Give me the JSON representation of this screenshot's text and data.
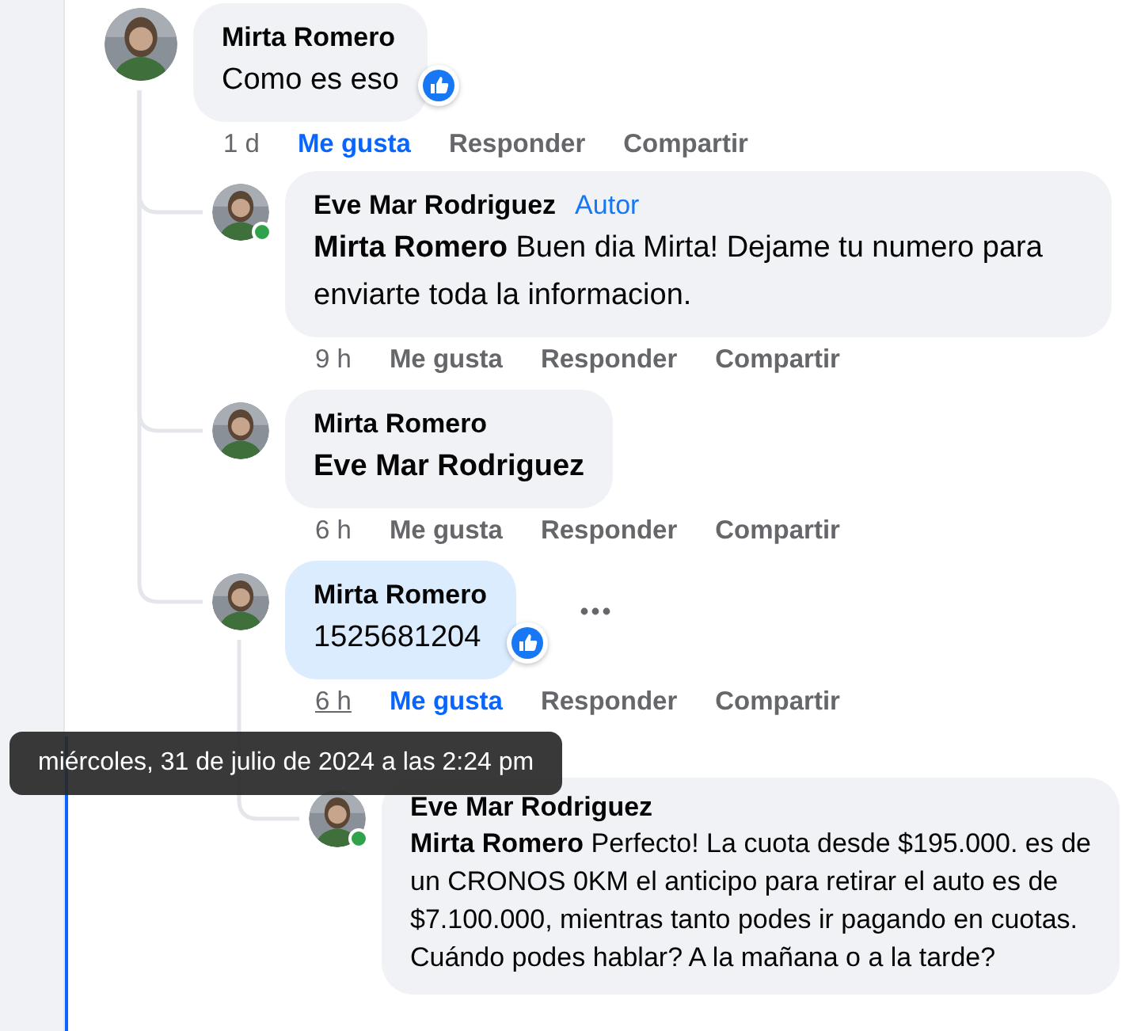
{
  "comments": [
    {
      "author": "Mirta Romero",
      "text": "Como es eso",
      "time": "1 d",
      "actions": [
        "Me gusta",
        "Responder",
        "Compartir"
      ],
      "liked": true,
      "like_badge": true,
      "online": false,
      "highlighted": false,
      "time_hovered": false,
      "more_button": false,
      "children": [
        {
          "author": "Eve Mar Rodriguez",
          "badge": "Autor",
          "mention": "Mirta Romero",
          "text": "Buen dia Mirta! Dejame tu numero para enviarte toda la informacion.",
          "time": "9 h",
          "actions": [
            "Me gusta",
            "Responder",
            "Compartir"
          ],
          "liked": false,
          "like_badge": false,
          "online": true,
          "highlighted": false,
          "time_hovered": false,
          "more_button": false
        },
        {
          "author": "Mirta Romero",
          "mention": "Eve Mar Rodriguez",
          "time": "6 h",
          "actions": [
            "Me gusta",
            "Responder",
            "Compartir"
          ],
          "liked": false,
          "like_badge": false,
          "online": false,
          "highlighted": false,
          "time_hovered": false,
          "more_button": false
        },
        {
          "author": "Mirta Romero",
          "text": "1525681204",
          "time": "6 h",
          "actions": [
            "Me gusta",
            "Responder",
            "Compartir"
          ],
          "liked": true,
          "like_badge": true,
          "online": false,
          "highlighted": true,
          "time_hovered": true,
          "more_button": true,
          "children": [
            {
              "author": "Eve Mar Rodriguez",
              "mention": "Mirta Romero",
              "text": "Perfecto! La cuota desde $195.000. es de un CRONOS 0KM el anticipo para retirar el auto es de $7.100.000, mientras tanto podes ir pagando en cuotas. Cuándo podes hablar? A la mañana o a la tarde?",
              "online": true,
              "highlighted": false,
              "like_badge": false,
              "more_button": false
            }
          ]
        }
      ]
    }
  ],
  "tooltip": "miércoles, 31 de julio de 2024 a las 2:24 pm"
}
